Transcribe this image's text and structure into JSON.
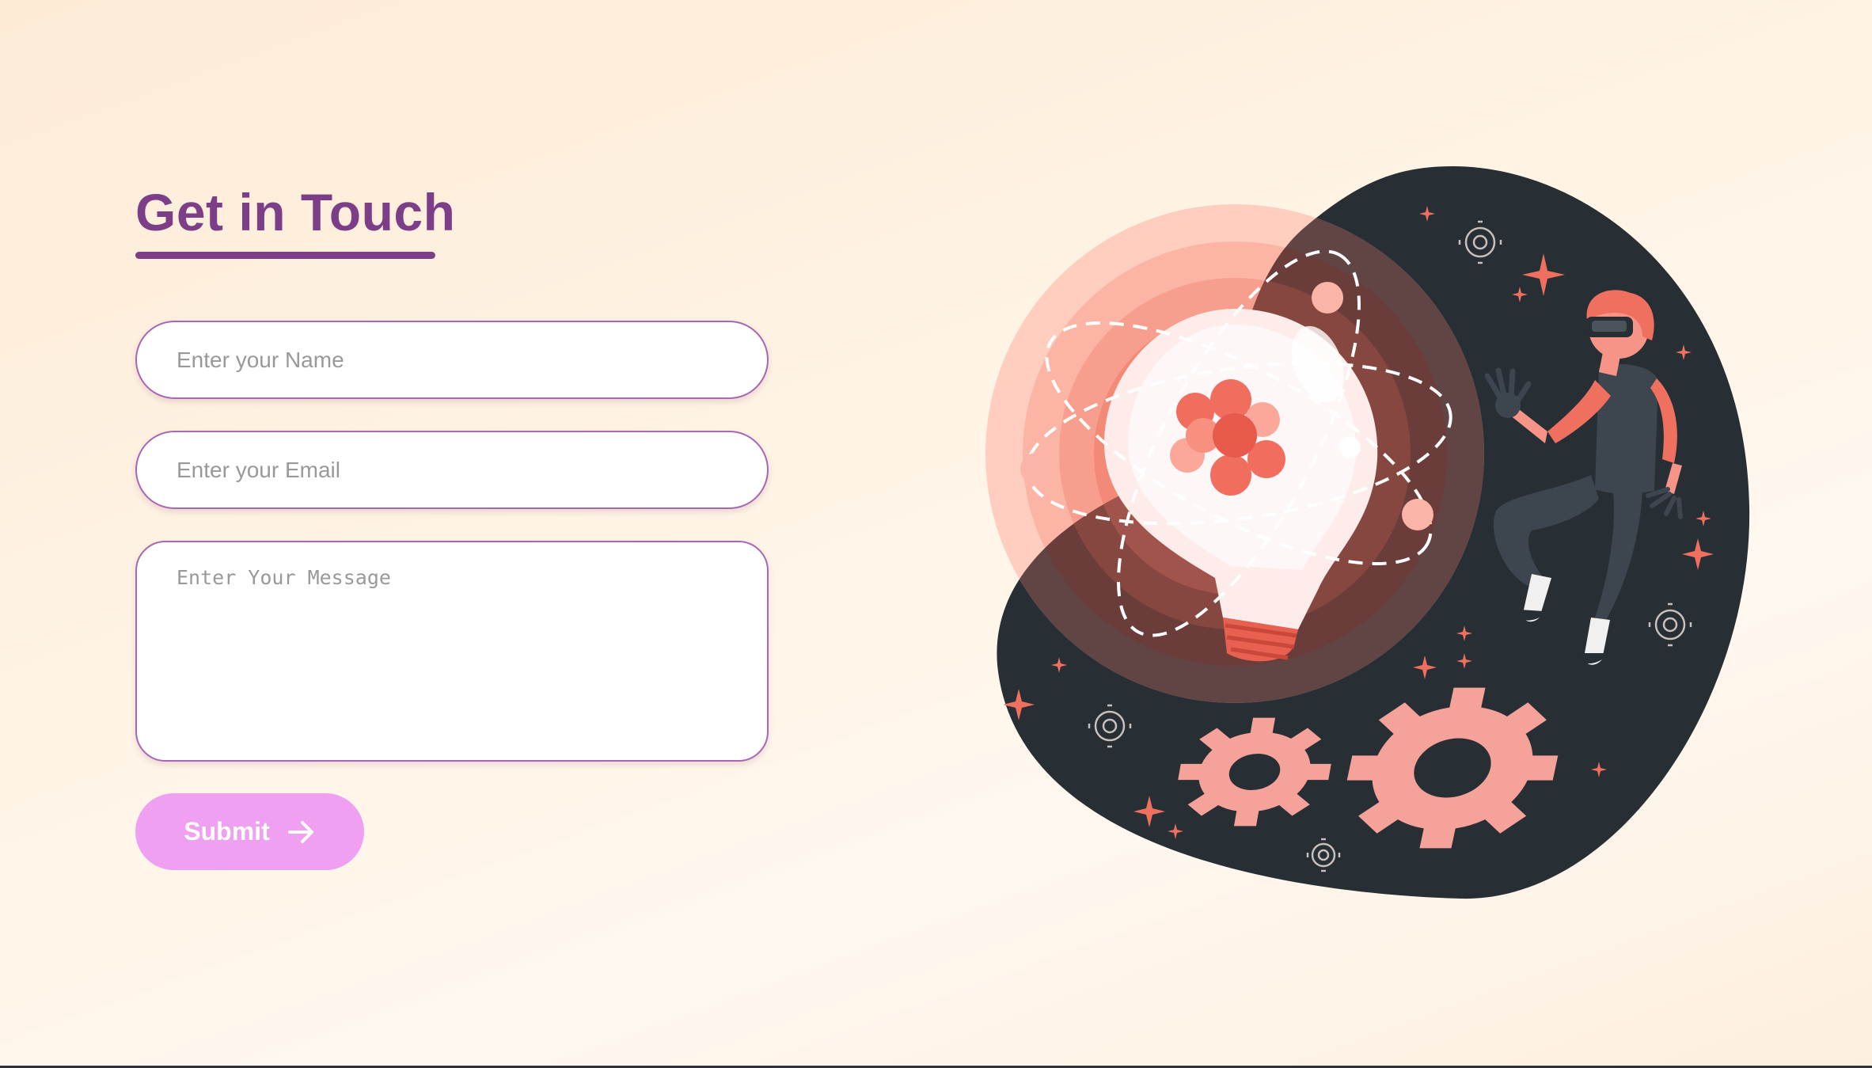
{
  "contact": {
    "title": "Get in Touch",
    "name_placeholder": "Enter your Name",
    "email_placeholder": "Enter your Email",
    "message_placeholder": "Enter Your Message",
    "submit_label": "Submit",
    "submit_icon": "arrow-right-icon"
  },
  "illustration": {
    "description_icons": [
      "light-bulb-icon",
      "atom-icon",
      "gear-icon",
      "person-vr-headset"
    ]
  },
  "colors": {
    "title": "#7c3f87",
    "field_border": "#a866b6",
    "submit_bg": "#f0a0f0",
    "blob_dark": "#272e34",
    "accent_coral": "#f0705f"
  }
}
